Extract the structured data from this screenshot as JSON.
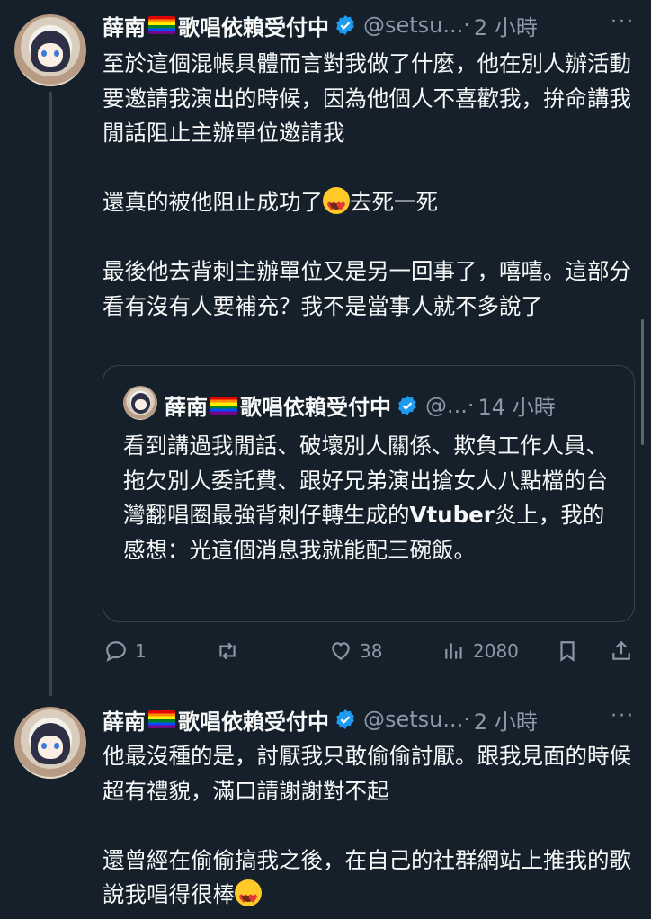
{
  "tweet1": {
    "name": "薛南",
    "name_suffix": "歌唱依賴受付中",
    "handle": "@setsu...",
    "separator": "·",
    "time": "2 小時",
    "more": "···",
    "paragraphs": [
      "至於這個混帳具體而言對我做了什麼，他在別人辦活動要邀請我演出的時候，因為他個人不喜歡我，拚命講我閒話阻止主辦單位邀請我",
      "還真的被他阻止成功了",
      "去死一死",
      "最後他去背刺主辦單位又是另一回事了，嘻嘻。這部分看有沒有人要補充？我不是當事人就不多說了"
    ],
    "quote": {
      "name": "薛南",
      "name_suffix": "歌唱依賴受付中",
      "handle": "@...",
      "separator": "·",
      "time": "14 小時",
      "text_before": "看到講過我閒話、破壞別人關係、欺負工作人員、拖欠別人委託費、跟好兄弟演出搶女人八點檔的台灣翻唱圈最強背刺仔轉生成的",
      "text_bold": "Vtuber",
      "text_after": "炎上，我的感想：光這個消息我就能配三碗飯。"
    },
    "actions": {
      "replies": "1",
      "retweets": "",
      "likes": "38",
      "views": "2080"
    }
  },
  "tweet2": {
    "name": "薛南",
    "name_suffix": "歌唱依賴受付中",
    "handle": "@setsu...",
    "separator": "·",
    "time": "2 小時",
    "more": "···",
    "paragraphs": [
      "他最沒種的是，討厭我只敢偷偷討厭。跟我見面的時候超有禮貌，滿口請謝謝對不起",
      "還曾經在偷偷搞我之後，在自己的社群網站上推我的歌說我唱得很棒"
    ]
  },
  "colors": {
    "background": "#15202b",
    "text": "#f7f9f9",
    "muted": "#8b98a5",
    "verified": "#1d9bf0",
    "border": "#38444d"
  }
}
